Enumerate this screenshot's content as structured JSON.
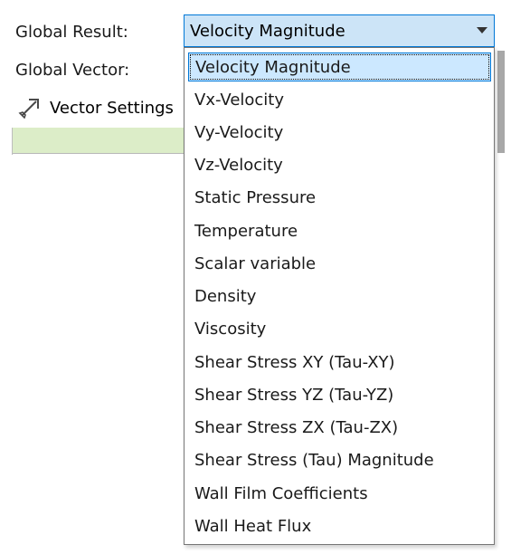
{
  "labels": {
    "global_result": "Global Result:",
    "global_vector": "Global Vector:"
  },
  "vector_settings": {
    "label": "Vector Settings",
    "icon": "arrow-icon"
  },
  "combo": {
    "selected_value": "Velocity Magnitude",
    "arrow_icon": "chevron-down-icon"
  },
  "dropdown": {
    "options": [
      {
        "label": "Velocity Magnitude",
        "selected": true
      },
      {
        "label": "Vx-Velocity"
      },
      {
        "label": "Vy-Velocity"
      },
      {
        "label": "Vz-Velocity"
      },
      {
        "label": "Static Pressure"
      },
      {
        "label": "Temperature"
      },
      {
        "label": "Scalar variable"
      },
      {
        "label": "Density"
      },
      {
        "label": "Viscosity"
      },
      {
        "label": "Shear Stress XY (Tau-XY)"
      },
      {
        "label": "Shear Stress YZ (Tau-YZ)"
      },
      {
        "label": "Shear Stress ZX (Tau-ZX)"
      },
      {
        "label": "Shear Stress (Tau) Magnitude"
      },
      {
        "label": "Wall Film Coefficients"
      },
      {
        "label": "Wall Heat Flux"
      }
    ]
  },
  "colors": {
    "selection_fill": "#cce8ff",
    "selection_border": "#0078d7",
    "combo_fill": "#cce4f7",
    "green_strip": "#dcedc8",
    "scroll_thumb": "#a8a8a8"
  }
}
